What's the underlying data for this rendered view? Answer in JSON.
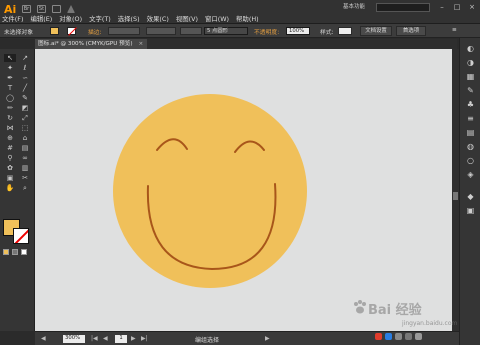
{
  "app": {
    "logo": "Ai"
  },
  "top_icons": [
    "Br",
    "St",
    "grid-icon",
    "sync-icon"
  ],
  "menu": [
    "文件(F)",
    "编辑(E)",
    "对象(O)",
    "文字(T)",
    "选择(S)",
    "效果(C)",
    "视图(V)",
    "窗口(W)",
    "帮助(H)"
  ],
  "workspace": "基本功能",
  "window_buttons": [
    "–",
    "□",
    "×"
  ],
  "control_bar": {
    "selection_label": "未选择对象",
    "stroke_label": "描边:",
    "brush_size": "5 点圆形",
    "opacity_label": "不透明度:",
    "opacity_value": "100%",
    "style_label": "样式:",
    "doc_setup": "文档设置",
    "preferences": "首选项"
  },
  "document_tab": {
    "title": "图标.ai* @ 300% (CMYK/GPU 预览)",
    "close": "×"
  },
  "tools": [
    {
      "name": "selection-tool",
      "glyph": "↖"
    },
    {
      "name": "direct-selection-tool",
      "glyph": "↗"
    },
    {
      "name": "magic-wand-tool",
      "glyph": "✦"
    },
    {
      "name": "lasso-tool",
      "glyph": "ℓ"
    },
    {
      "name": "pen-tool",
      "glyph": "✒"
    },
    {
      "name": "curvature-tool",
      "glyph": "∽"
    },
    {
      "name": "type-tool",
      "glyph": "T"
    },
    {
      "name": "line-tool",
      "glyph": "╱"
    },
    {
      "name": "ellipse-tool",
      "glyph": "◯"
    },
    {
      "name": "paintbrush-tool",
      "glyph": "✎"
    },
    {
      "name": "pencil-tool",
      "glyph": "✏"
    },
    {
      "name": "eraser-tool",
      "glyph": "◩"
    },
    {
      "name": "rotate-tool",
      "glyph": "↻"
    },
    {
      "name": "scale-tool",
      "glyph": "⤢"
    },
    {
      "name": "width-tool",
      "glyph": "⋈"
    },
    {
      "name": "free-transform-tool",
      "glyph": "⬚"
    },
    {
      "name": "shape-builder-tool",
      "glyph": "⊕"
    },
    {
      "name": "perspective-tool",
      "glyph": "⌂"
    },
    {
      "name": "mesh-tool",
      "glyph": "#"
    },
    {
      "name": "gradient-tool",
      "glyph": "▤"
    },
    {
      "name": "eyedropper-tool",
      "glyph": "⚲"
    },
    {
      "name": "blend-tool",
      "glyph": "∞"
    },
    {
      "name": "symbol-sprayer-tool",
      "glyph": "✿"
    },
    {
      "name": "column-graph-tool",
      "glyph": "▥"
    },
    {
      "name": "artboard-tool",
      "glyph": "▣"
    },
    {
      "name": "slice-tool",
      "glyph": "✂"
    },
    {
      "name": "hand-tool",
      "glyph": "✋"
    },
    {
      "name": "zoom-tool",
      "glyph": "⌕"
    }
  ],
  "dock_icons": [
    "color-panel-icon",
    "color-guide-icon",
    "swatches-icon",
    "brushes-icon",
    "symbols-icon",
    "stroke-icon",
    "gradient-icon",
    "transparency-icon",
    "appearance-icon",
    "graphic-styles-icon",
    "layers-icon",
    "artboards-icon"
  ],
  "status": {
    "zoom": "300%",
    "page": "1",
    "tool_name": "编组选择"
  },
  "watermark": {
    "main": "Bai 经验",
    "sub": "jingyan.baidu.com"
  },
  "colors": {
    "face_fill": "#f0c05a",
    "feature_stroke": "#a8561a",
    "canvas_bg": "#dfe0e0",
    "accent": "#ff9a00"
  }
}
